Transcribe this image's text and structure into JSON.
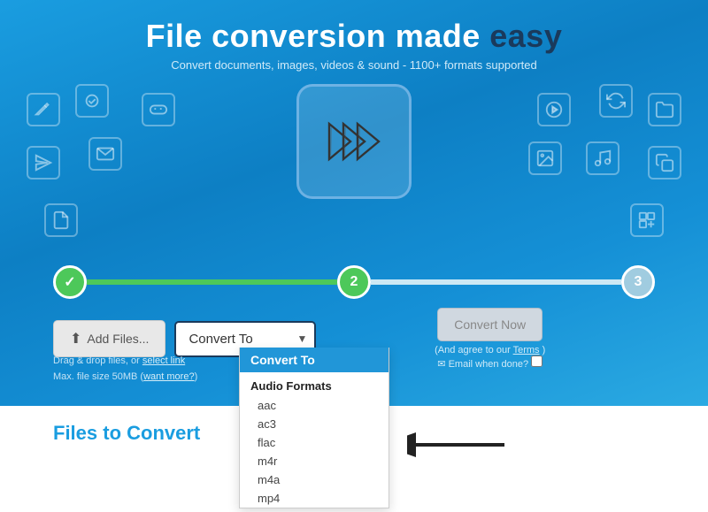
{
  "header": {
    "title_part1": "File ",
    "title_part2": "conversion",
    "title_part3": " made ",
    "title_part4": "easy",
    "subtitle": "Convert documents, images, videos & sound - 1100+ formats supported"
  },
  "steps": [
    {
      "number": "✓",
      "state": "done"
    },
    {
      "number": "2",
      "state": "active"
    },
    {
      "number": "3",
      "state": "inactive"
    }
  ],
  "actions": {
    "add_files_label": "Add Files...",
    "convert_to_label": "Convert To",
    "convert_now_label": "Convert Now",
    "agree_text": "(And agree to our",
    "terms_link": "Terms",
    "agree_close": ")",
    "email_label": "✉ Email when done?"
  },
  "helper": {
    "line1": "Drag & drop files, or",
    "select_link": "select link",
    "line2": "Max. file size 50MB (",
    "want_more_link": "want more?",
    "line2_close": ")"
  },
  "dropdown": {
    "header": "Convert To",
    "group_label": "Audio Formats",
    "items": [
      "aac",
      "ac3",
      "flac",
      "m4r",
      "m4a",
      "mp4"
    ]
  },
  "files_section": {
    "label_part1": "Files to ",
    "label_part2": "Convert"
  },
  "colors": {
    "accent": "#1a9de0",
    "dark": "#1a3a5c",
    "green": "#4dc85a"
  }
}
